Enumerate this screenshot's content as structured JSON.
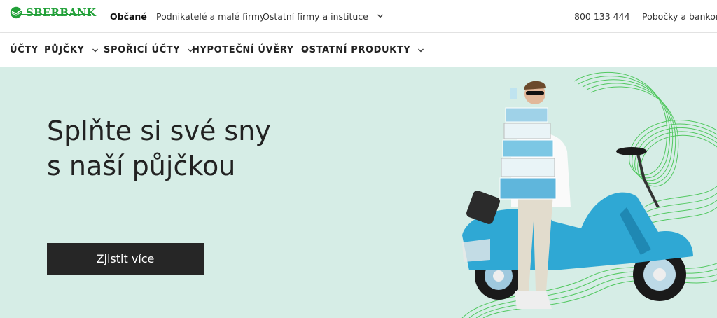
{
  "brand": {
    "name": "SBERBANK",
    "color": "#21a038",
    "icon": "sberbank-logo-icon"
  },
  "top_nav": {
    "items": [
      "Občané",
      "Podnikatelé a malé firmy",
      "Ostatní firmy a instituce"
    ],
    "phone": "800 133 444",
    "branches": "Pobočky a bankomaty"
  },
  "sub_nav": {
    "items": [
      "ÚČTY",
      "PŮJČKY",
      "SPOŘICÍ ÚČTY",
      "HYPOTEČNÍ ÚVĚRY",
      "OSTATNÍ PRODUKTY"
    ]
  },
  "hero": {
    "title_line1": "Splňte si své sny",
    "title_line2": "s naší půjčkou",
    "cta_label": "Zjistit více",
    "background_color": "#d6ede6"
  }
}
